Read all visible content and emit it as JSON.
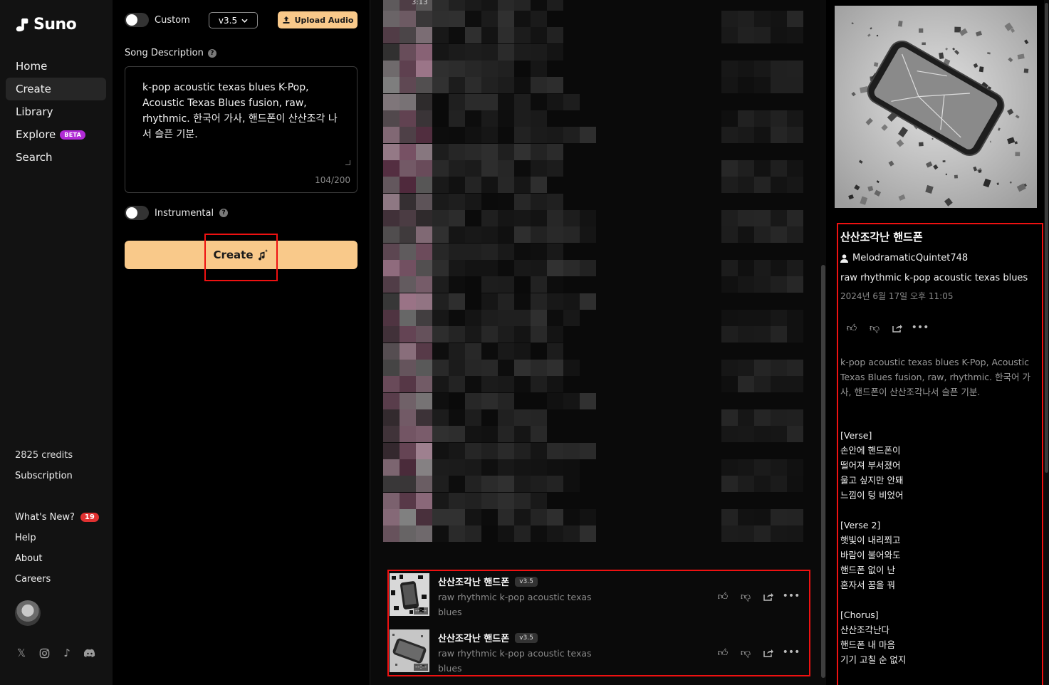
{
  "brand": {
    "name": "Suno"
  },
  "nav": [
    {
      "label": "Home",
      "active": false
    },
    {
      "label": "Create",
      "active": true
    },
    {
      "label": "Library",
      "active": false
    },
    {
      "label": "Explore",
      "active": false,
      "badge": "BETA"
    },
    {
      "label": "Search",
      "active": false
    }
  ],
  "account": {
    "credits": "2825 credits",
    "subscription": "Subscription"
  },
  "links": {
    "whats_new": "What's New?",
    "whats_new_count": "19",
    "help": "Help",
    "about": "About",
    "careers": "Careers"
  },
  "socials": [
    "x-icon",
    "instagram-icon",
    "tiktok-icon",
    "discord-icon"
  ],
  "create_form": {
    "custom_label": "Custom",
    "version": "v3.5",
    "upload_label": "Upload Audio",
    "description_label": "Song Description",
    "description_value": "k-pop acoustic texas blues K-Pop, Acoustic Texas Blues fusion, raw, rhythmic. 한국어 가사, 핸드폰이 산산조각 나서 슬픈 기분.",
    "char_count": "104/200",
    "instrumental_label": "Instrumental",
    "create_label": "Create"
  },
  "feed": {
    "top_duration": "3:13",
    "songs": [
      {
        "title": "산산조각난 핸드폰",
        "version": "v3.5",
        "style": "raw rhythmic k-pop acoustic texas blues",
        "duration": "--:--"
      },
      {
        "title": "산산조각난 핸드폰",
        "version": "v3.5",
        "style": "raw rhythmic k-pop acoustic texas blues",
        "duration": "--:--"
      }
    ]
  },
  "detail": {
    "title": "산산조각난 핸드폰",
    "user": "MelodramaticQuintet748",
    "style": "raw rhythmic k-pop acoustic texas blues",
    "date": "2024년 6월 17일 오후 11:05",
    "prompt": "k-pop acoustic texas blues K-Pop, Acoustic Texas Blues fusion, raw, rhythmic. 한국어 가사, 핸드폰이 산산조각나서 슬픈 기분.",
    "lyrics": "[Verse]\n손안에 핸드폰이\n떨어져 부서졌어\n울고 싶지만 안돼\n느낌이 텅 비었어\n\n[Verse 2]\n햇빛이 내리쬐고\n바람이 불어와도\n핸드폰 없이 난\n혼자서 꿈을 꿔\n\n[Chorus]\n산산조각난다\n핸드폰 내 마음\n기기 고칠 순 없지"
  },
  "colors": {
    "accent": "#f9c98a",
    "highlight": "#e11111",
    "badge_beta": "#b12bd6",
    "notif": "#e03131"
  }
}
